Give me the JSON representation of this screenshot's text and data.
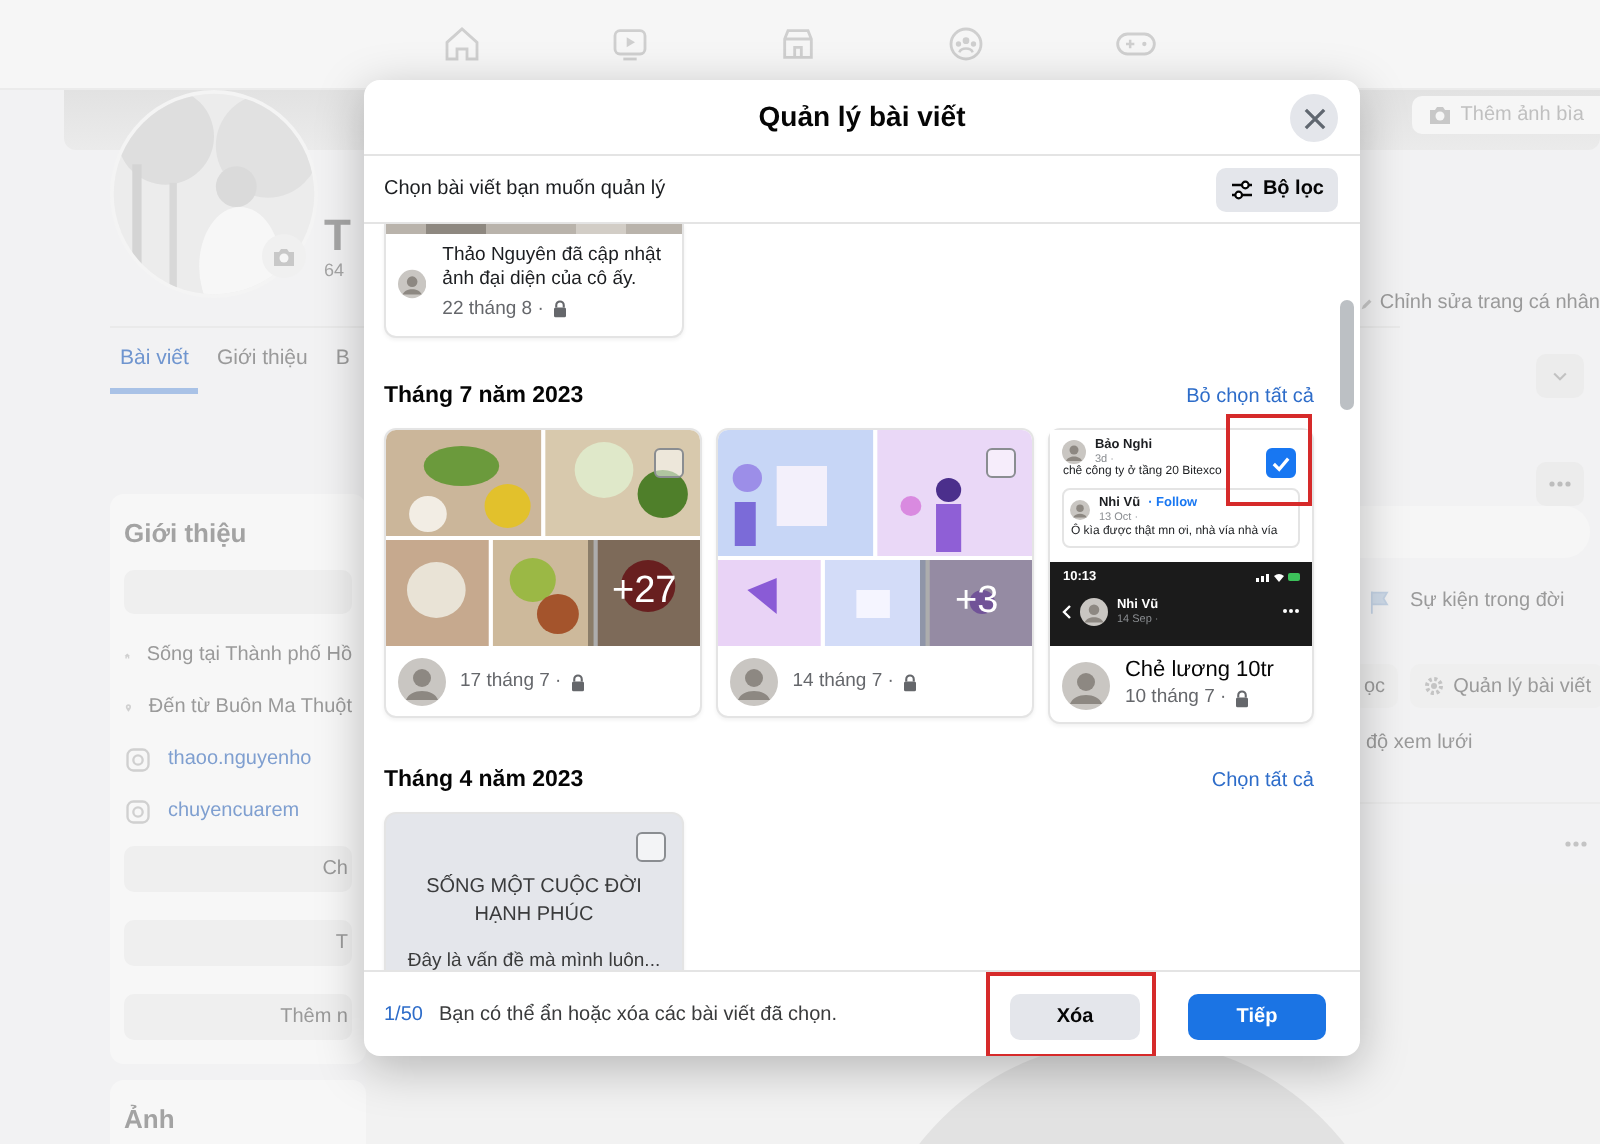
{
  "background": {
    "cover_button": "Thêm ảnh bìa",
    "name": "T",
    "friends": "64",
    "edit_button": "Chỉnh sửa trang cá nhân",
    "tabs": [
      {
        "label": "Bài viết",
        "selected": true
      },
      {
        "label": "Giới thiệu",
        "selected": false
      },
      {
        "label": "B",
        "selected": false
      }
    ],
    "intro": {
      "title": "Giới thiệu",
      "items": [
        {
          "kind": "home",
          "text": "Sống tại Thành phố Hồ"
        },
        {
          "kind": "pin",
          "text": "Đến từ Buôn Ma Thuột"
        },
        {
          "kind": "instagram",
          "text": "thaoo.nguyenho"
        },
        {
          "kind": "instagram",
          "text": "chuyencuarem"
        }
      ],
      "buttons": [
        "Ch",
        "T",
        "Thêm n"
      ]
    },
    "photos_title": "Ảnh",
    "life_event": "Sự kiện trong đời",
    "post_tools": [
      {
        "kind": "filter",
        "label": "ọc"
      },
      {
        "kind": "manage",
        "label": "Quản lý bài viết"
      }
    ],
    "view_tab": "độ xem lưới"
  },
  "modal": {
    "title": "Quản lý bài viết",
    "subtitle": "Chọn bài viết bạn muốn quản lý",
    "filter_button": "Bộ lọc",
    "groups": [
      {
        "posts": [
          {
            "kind": "status",
            "caption": "Thảo Nguyên đã cập nhật ảnh đại diện của cô ấy.",
            "date": "22 tháng 8 ·"
          }
        ]
      },
      {
        "title": "Tháng 7 năm 2023",
        "action": "Bỏ chọn tất cả",
        "posts": [
          {
            "kind": "photos",
            "more": "+27",
            "date": "17 tháng 7 ·",
            "selected": false,
            "highlighted": false
          },
          {
            "kind": "graphics",
            "more": "+3",
            "date": "14 tháng 7 ·",
            "selected": false,
            "highlighted": false
          },
          {
            "kind": "shared",
            "caption": "Chẻ lương 10tr",
            "date": "10 tháng 7 ·",
            "selected": true,
            "highlighted": true,
            "preview": {
              "author": "Bảo Nghi",
              "time": "3d ·",
              "text": "chê công ty ở tầng 20 Bitexco",
              "quote_author": "Nhi Vũ",
              "quote_follow": "· Follow",
              "quote_time": "13 Oct ·",
              "quote_text": "Ô kìa được thật mn ơi, nhà vía nhà vía",
              "phone_time": "10:13",
              "phone_name": "Nhi Vũ",
              "phone_date": "14 Sep ·"
            }
          }
        ]
      },
      {
        "title": "Tháng 4 năm 2023",
        "action": "Chọn tất cả",
        "posts": [
          {
            "kind": "text",
            "heading": "SỐNG MỘT CUỘC ĐỜI HẠNH PHÚC",
            "body": "Đây là vấn đề mà mình luôn...",
            "selected": false,
            "highlighted": false
          }
        ]
      }
    ],
    "footer": {
      "count": "1/50",
      "note": "Bạn có thể ẩn hoặc xóa các bài viết đã chọn.",
      "buttons": [
        {
          "label": "Xóa",
          "kind": "secondary",
          "highlighted": true
        },
        {
          "label": "Tiếp",
          "kind": "primary",
          "highlighted": false
        }
      ]
    }
  }
}
